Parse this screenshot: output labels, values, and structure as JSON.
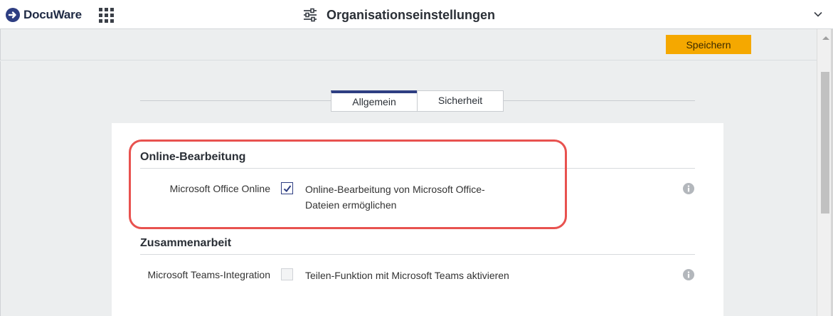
{
  "app": {
    "name": "DocuWare",
    "brand_color": "#2e3e82",
    "accent_color": "#f5a800"
  },
  "header": {
    "title": "Organisationseinstellungen"
  },
  "toolbar": {
    "save_label": "Speichern"
  },
  "tabs": [
    {
      "label": "Allgemein",
      "active": true
    },
    {
      "label": "Sicherheit",
      "active": false
    }
  ],
  "sections": [
    {
      "title": "Online-Bearbeitung",
      "rows": [
        {
          "label": "Microsoft Office Online",
          "checked": true,
          "enabled": true,
          "description": "Online-Bearbeitung von Microsoft Office-Dateien ermöglichen"
        }
      ]
    },
    {
      "title": "Zusammenarbeit",
      "rows": [
        {
          "label": "Microsoft Teams-Integration",
          "checked": false,
          "enabled": false,
          "description": "Teilen-Funktion mit Microsoft Teams aktivieren"
        }
      ]
    }
  ],
  "icons": {
    "logo": "docuware-logo-icon",
    "apps": "apps-grid-icon",
    "settings": "sliders-icon",
    "expand": "chevron-down-icon",
    "info": "info-icon"
  },
  "highlight_color": "#e8524f"
}
